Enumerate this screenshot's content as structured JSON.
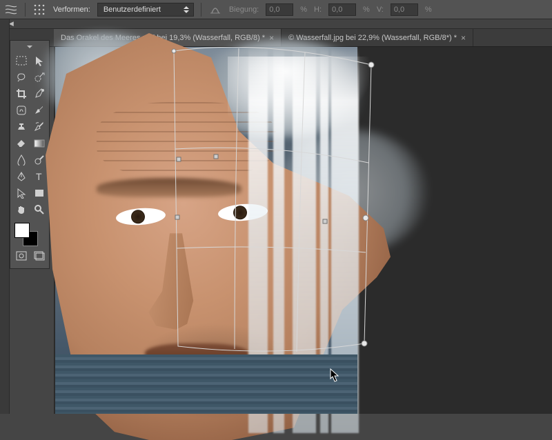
{
  "options_bar": {
    "transform_label": "Verformen:",
    "transform_mode": "Benutzerdefiniert",
    "bend_label": "Biegung:",
    "bend_value": "0,0",
    "percent": "%",
    "h_label": "H:",
    "h_value": "0,0",
    "v_label": "V:",
    "v_value": "0,0"
  },
  "tabs": [
    {
      "label": "Das Orakel des Meeres.psd bei 19,3%  (Wasserfall, RGB/8) *",
      "active": true
    },
    {
      "label": "© Wasserfall.jpg bei 22,9% (Wasserfall, RGB/8*) *",
      "active": false
    }
  ],
  "colors": {
    "foreground": "#ffffff",
    "background": "#000000"
  },
  "tools": {
    "row1": [
      "move-tool-icon",
      "direct-select-icon"
    ],
    "row2": [
      "lasso-tool-icon",
      "quick-select-icon"
    ],
    "row3": [
      "crop-tool-icon",
      "eyedropper-icon"
    ],
    "row4": [
      "healing-brush-icon",
      "brush-tool-icon"
    ],
    "row5": [
      "stamp-tool-icon",
      "history-brush-icon"
    ],
    "row6": [
      "eraser-tool-icon",
      "gradient-tool-icon"
    ],
    "row7": [
      "blur-tool-icon",
      "dodge-tool-icon"
    ],
    "row8": [
      "pen-tool-icon",
      "type-tool-icon"
    ],
    "row9": [
      "path-select-icon",
      "shape-tool-icon"
    ],
    "row10": [
      "hand-tool-icon",
      "zoom-tool-icon"
    ]
  }
}
